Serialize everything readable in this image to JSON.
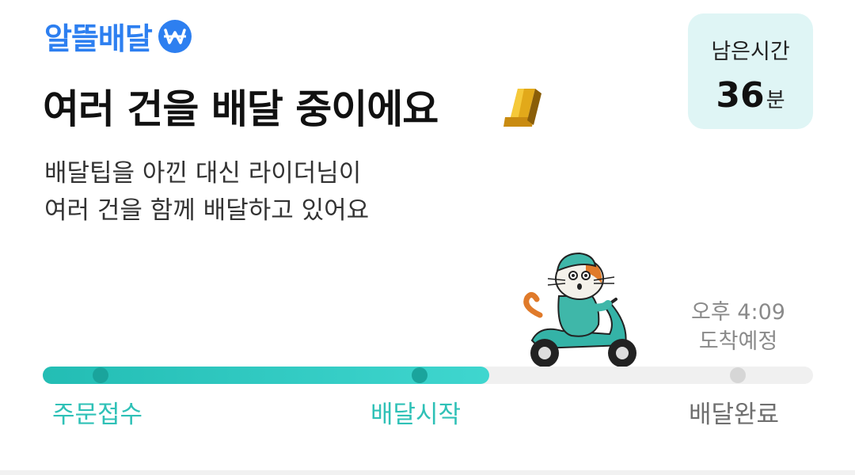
{
  "brand": {
    "name": "알뜰배달"
  },
  "timer": {
    "label": "남은시간",
    "value": "36",
    "unit": "분"
  },
  "headline": "여러 건을 배달 중이에요",
  "subtitle": {
    "line1": "배달팁을 아낀 대신 라이더님이",
    "line2": "여러 건을 함께 배달하고 있어요"
  },
  "eta": {
    "time": "오후 4:09",
    "label": "도착예정"
  },
  "progress": {
    "fraction": 0.58,
    "steps": [
      {
        "label": "주문접수",
        "status": "done"
      },
      {
        "label": "배달시작",
        "status": "done"
      },
      {
        "label": "배달완료",
        "status": "pending"
      }
    ]
  },
  "colors": {
    "brand": "#2d7ff0",
    "accent": "#2fc1b7",
    "timer_bg": "#dff5f5"
  },
  "icons": {
    "brand_badge": "won-coin-icon",
    "order_badge": "number-one-badge-icon",
    "rider": "cat-rider-scooter-illustration"
  }
}
